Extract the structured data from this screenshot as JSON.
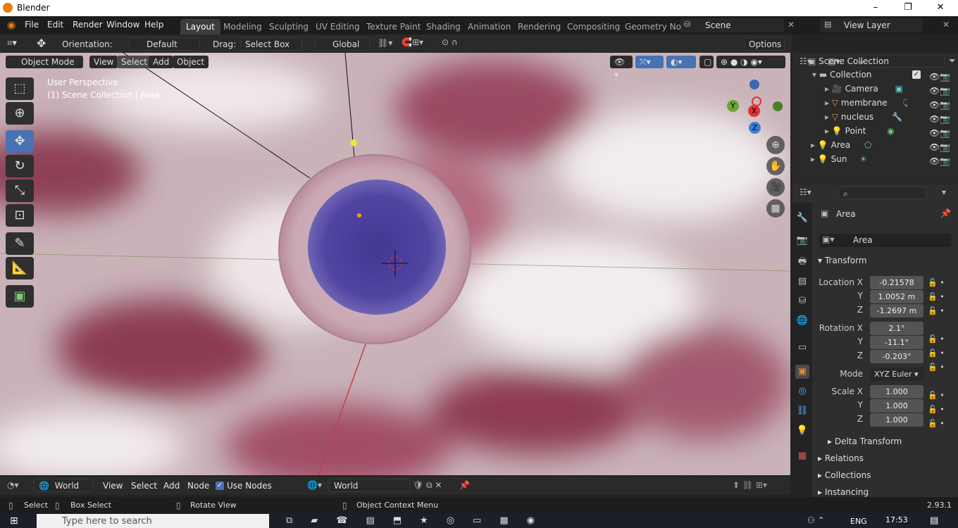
{
  "window": {
    "title": "Blender",
    "minimize": "–",
    "maximize": "❐",
    "close": "✕"
  },
  "menu": {
    "items": [
      "File",
      "Edit",
      "Render",
      "Window",
      "Help"
    ]
  },
  "workspaces": [
    "Layout",
    "Modeling",
    "Sculpting",
    "UV Editing",
    "Texture Paint",
    "Shading",
    "Animation",
    "Rendering",
    "Compositing",
    "Geometry No"
  ],
  "scene": {
    "name": "Scene",
    "view_layer": "View Layer"
  },
  "viewport_header": {
    "orientation_label": "Orientation:",
    "orientation_value": "Default",
    "drag_label": "Drag:",
    "drag_value": "Select Box",
    "transform_space": "Global",
    "options": "Options"
  },
  "viewport_menu": {
    "mode": "Object Mode",
    "view": "View",
    "select": "Select",
    "add": "Add",
    "object": "Object"
  },
  "viewport_info": {
    "perspective": "User Perspective",
    "context": "(1) Scene Collection | Area"
  },
  "gizmo": {
    "x": "X",
    "y": "Y",
    "z": "Z"
  },
  "outliner": {
    "search_placeholder": "",
    "root": "Scene Collection",
    "collection": "Collection",
    "items": [
      {
        "name": "Camera",
        "icon": "camera-icon"
      },
      {
        "name": "membrane",
        "icon": "mesh-icon"
      },
      {
        "name": "nucleus",
        "icon": "mesh-icon"
      },
      {
        "name": "Point",
        "icon": "light-icon"
      }
    ],
    "top_items": [
      {
        "name": "Area",
        "icon": "light-icon"
      },
      {
        "name": "Sun",
        "icon": "sun-icon"
      }
    ]
  },
  "properties": {
    "object_name": "Area",
    "data_name": "Area",
    "transform_title": "Transform",
    "location": {
      "label_x": "Location X",
      "x": "-0.21578",
      "y": "1.0052 m",
      "z": "-1.2697 m"
    },
    "rotation": {
      "label_x": "Rotation X",
      "x": "2.1°",
      "y": "-11.1°",
      "z": "-0.203°"
    },
    "mode_label": "Mode",
    "mode_value": "XYZ Euler",
    "scale": {
      "label_x": "Scale X",
      "x": "1.000",
      "y": "1.000",
      "z": "1.000"
    },
    "axis_y": "Y",
    "axis_z": "Z",
    "delta": "Delta Transform",
    "sections": [
      "Relations",
      "Collections",
      "Instancing"
    ]
  },
  "shader_header": {
    "world_type": "World",
    "view": "View",
    "select": "Select",
    "add": "Add",
    "node": "Node",
    "use_nodes": "Use Nodes",
    "world_name": "World"
  },
  "status_bar": {
    "select": "Select",
    "box_select": "Box Select",
    "rotate": "Rotate View",
    "context_menu": "Object Context Menu",
    "version": "2.93.1"
  },
  "taskbar": {
    "search_placeholder": "Type here to search",
    "lang": "ENG",
    "time": "17:53"
  }
}
